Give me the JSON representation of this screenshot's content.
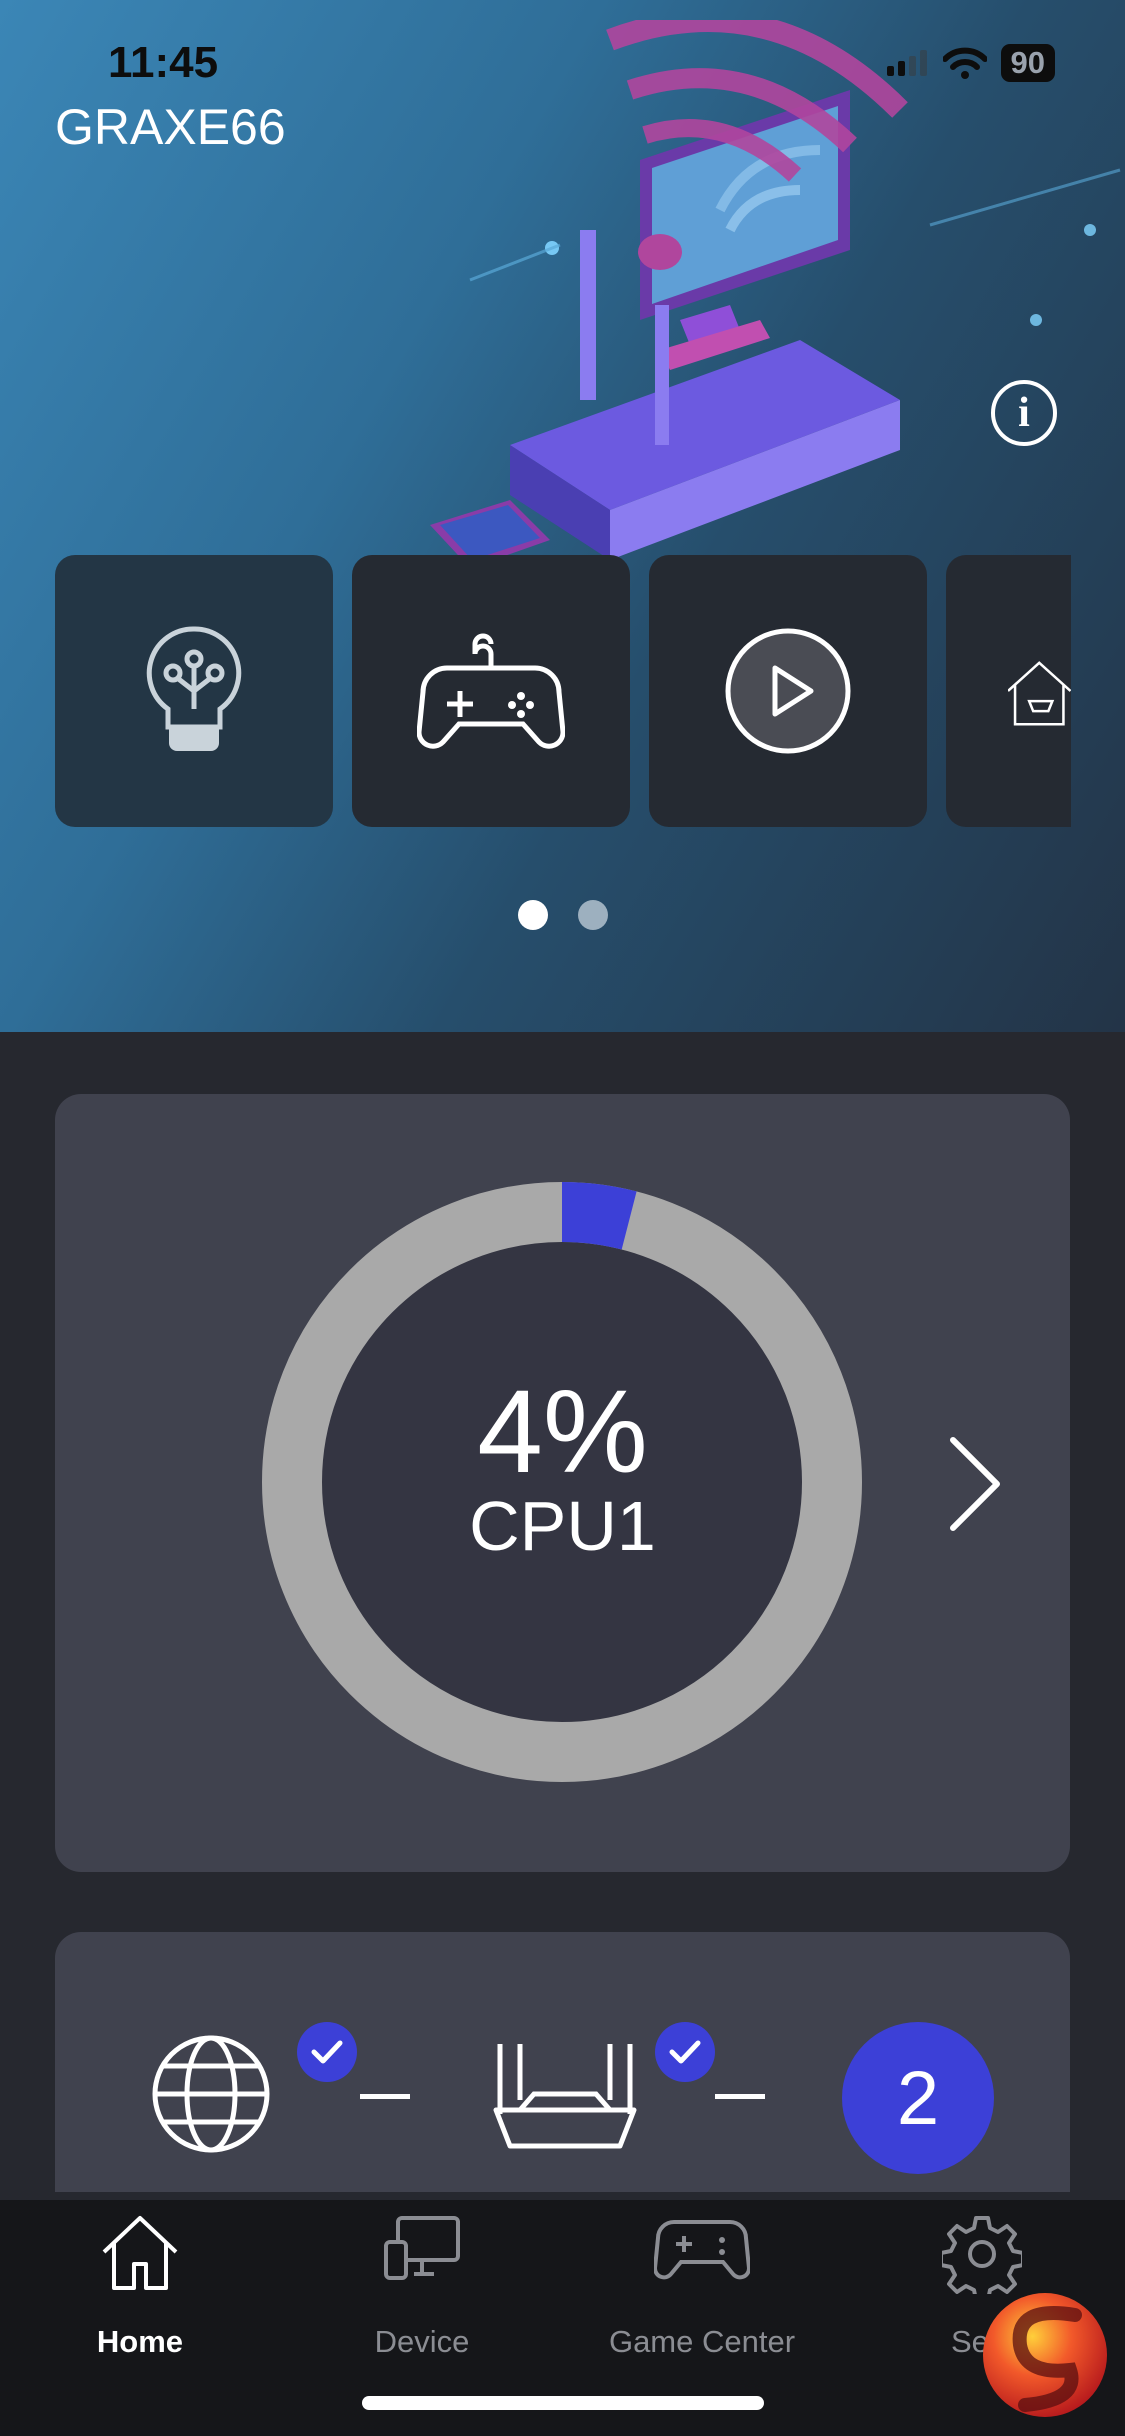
{
  "status_bar": {
    "time": "11:45",
    "battery": "90"
  },
  "header": {
    "title": "GRAXE66"
  },
  "mode_cards": [
    {
      "icon": "lightbulb-icon"
    },
    {
      "icon": "gamepad-icon"
    },
    {
      "icon": "play-circle-icon"
    },
    {
      "icon": "home-icon"
    }
  ],
  "pager": {
    "pages": 2,
    "current": 1
  },
  "cpu": {
    "value": "4%",
    "label": "CPU1",
    "usage_fraction": 0.04,
    "ring_color": "#3c40d7",
    "track_color": "#a9a9a9"
  },
  "network": {
    "internet_connected": true,
    "router_connected": true,
    "device_count": "2"
  },
  "tabs": [
    {
      "label": "Home",
      "icon": "home-icon",
      "active": true
    },
    {
      "label": "Device",
      "icon": "device-icon",
      "active": false
    },
    {
      "label": "Game Center",
      "icon": "gamepad-icon",
      "active": false
    },
    {
      "label": "Setti",
      "icon": "gear-icon",
      "active": false
    }
  ],
  "colors": {
    "accent": "#3c40d7",
    "card": "#40424e",
    "background": "#26282f"
  }
}
